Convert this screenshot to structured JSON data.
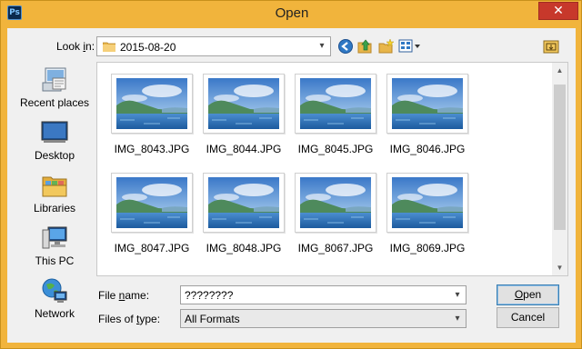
{
  "window": {
    "title": "Open",
    "app_icon_text": "Ps",
    "close_glyph": "✕",
    "frame_color": "#f1b43c"
  },
  "toolbar": {
    "look_in_label_pre": "Look ",
    "look_in_label_acc": "i",
    "look_in_label_post": "n:",
    "look_in_value": "2015-08-20",
    "icons": [
      "back-icon",
      "up-folder-icon",
      "new-folder-icon",
      "view-menu-icon",
      "folder-options-icon"
    ]
  },
  "places": [
    {
      "label": "Recent places",
      "icon": "recent-places-icon"
    },
    {
      "label": "Desktop",
      "icon": "desktop-icon"
    },
    {
      "label": "Libraries",
      "icon": "libraries-icon"
    },
    {
      "label": "This PC",
      "icon": "this-pc-icon"
    },
    {
      "label": "Network",
      "icon": "network-icon"
    }
  ],
  "files": [
    "IMG_8043.JPG",
    "IMG_8044.JPG",
    "IMG_8045.JPG",
    "IMG_8046.JPG",
    "IMG_8047.JPG",
    "IMG_8048.JPG",
    "IMG_8067.JPG",
    "IMG_8069.JPG"
  ],
  "form": {
    "file_name_label_pre": "File ",
    "file_name_label_acc": "n",
    "file_name_label_post": "ame:",
    "file_name_value": "????????",
    "files_of_type_label_pre": "Files of ",
    "files_of_type_label_acc": "t",
    "files_of_type_label_post": "ype:",
    "files_of_type_value": "All Formats"
  },
  "buttons": {
    "open_acc": "O",
    "open_rest": "pen",
    "cancel": "Cancel"
  },
  "colors": {
    "accent": "#3c7fb1",
    "close": "#c7382b"
  }
}
